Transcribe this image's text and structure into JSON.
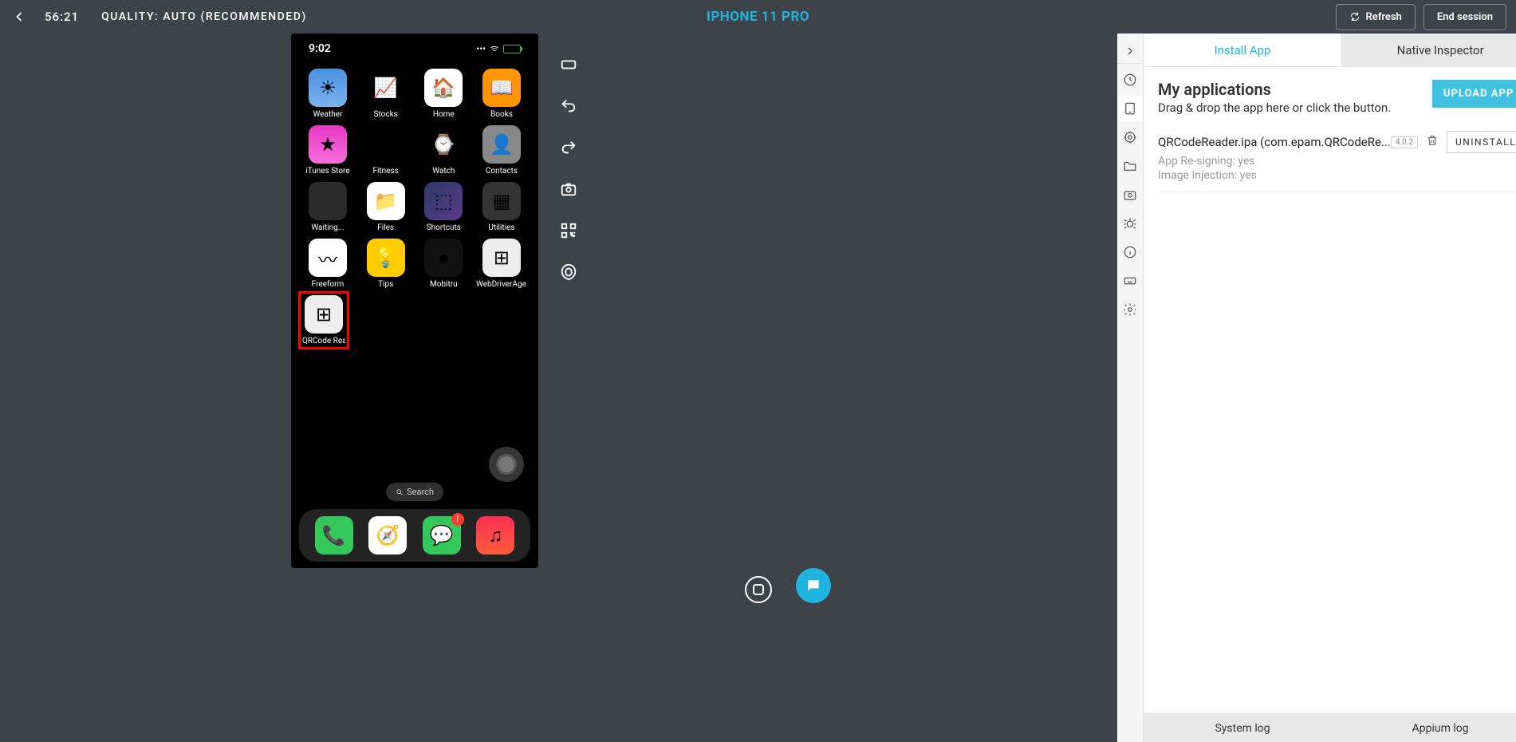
{
  "topbar": {
    "timer": "56:21",
    "quality": "QUALITY: AUTO (RECOMMENDED)",
    "device_title": "IPHONE 11 PRO",
    "refresh_label": "Refresh",
    "end_session_label": "End session"
  },
  "phone": {
    "clock": "9:02",
    "apps": {
      "row1": [
        {
          "label": "Weather",
          "cls": "ic-weather",
          "glyph": "☀"
        },
        {
          "label": "Stocks",
          "cls": "ic-stocks",
          "glyph": "📈"
        },
        {
          "label": "Home",
          "cls": "ic-home",
          "glyph": "🏠"
        },
        {
          "label": "Books",
          "cls": "ic-books",
          "glyph": "📖"
        }
      ],
      "row2": [
        {
          "label": "iTunes Store",
          "cls": "ic-itunes",
          "glyph": "★"
        },
        {
          "label": "Fitness",
          "cls": "ic-fitness",
          "glyph": "◯"
        },
        {
          "label": "Watch",
          "cls": "ic-watch",
          "glyph": "⌚"
        },
        {
          "label": "Contacts",
          "cls": "ic-contacts",
          "glyph": "👤"
        }
      ],
      "row3": [
        {
          "label": "Waiting...",
          "cls": "ic-waiting",
          "glyph": ""
        },
        {
          "label": "Files",
          "cls": "ic-files",
          "glyph": "📁"
        },
        {
          "label": "Shortcuts",
          "cls": "ic-shortcuts",
          "glyph": "⬚"
        },
        {
          "label": "Utilities",
          "cls": "ic-utilities",
          "glyph": "▦"
        }
      ],
      "row4": [
        {
          "label": "Freeform",
          "cls": "ic-freeform",
          "glyph": "〰"
        },
        {
          "label": "Tips",
          "cls": "ic-tips",
          "glyph": "💡"
        },
        {
          "label": "Mobitru",
          "cls": "ic-mobitru",
          "glyph": "●"
        },
        {
          "label": "WebDriverAge...",
          "cls": "ic-wda",
          "glyph": "⊞"
        }
      ],
      "row5": [
        {
          "label": "QRCode Reader",
          "cls": "ic-qr",
          "glyph": "⊞",
          "highlight": true
        }
      ]
    },
    "search_label": "Search",
    "dock": [
      {
        "name": "phone",
        "cls": "ic-phone",
        "glyph": "📞"
      },
      {
        "name": "safari",
        "cls": "ic-safari",
        "glyph": "🧭"
      },
      {
        "name": "messages",
        "cls": "ic-messages",
        "glyph": "💬",
        "badge": "!"
      },
      {
        "name": "music",
        "cls": "ic-music",
        "glyph": "♫"
      }
    ]
  },
  "panel": {
    "tabs": {
      "install": "Install App",
      "inspector": "Native Inspector"
    },
    "apps_title": "My applications",
    "apps_sub": "Drag & drop the app here or click the button.",
    "upload_label": "UPLOAD APP",
    "entry": {
      "name": "QRCodeReader.ipa (com.epam.QRCodeRe...",
      "version": "4.0.2",
      "uninstall_label": "UNINSTALL",
      "resigning": "App Re-signing: yes",
      "injection": "Image Injection: yes"
    },
    "bottom": {
      "system": "System log",
      "appium": "Appium log"
    }
  }
}
